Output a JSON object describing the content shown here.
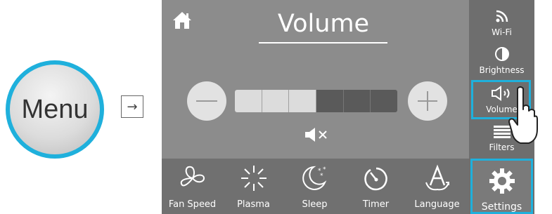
{
  "intro": {
    "menu_label": "Menu",
    "arrow": "→"
  },
  "screen": {
    "title": "Volume",
    "icons": {
      "home": "home-icon",
      "minus": "minus-icon",
      "plus": "plus-icon",
      "mute": "mute-icon"
    },
    "volume": {
      "level": 3,
      "max": 6
    }
  },
  "sidebar": {
    "items": [
      {
        "label": "Wi-Fi",
        "icon": "wifi-icon"
      },
      {
        "label": "Brightness",
        "icon": "brightness-icon"
      },
      {
        "label": "Volume",
        "icon": "volume-icon",
        "selected": true
      },
      {
        "label": "Filters",
        "icon": "filters-icon"
      },
      {
        "label": "Settings",
        "icon": "settings-icon",
        "selected": true
      }
    ]
  },
  "bottom_bar": {
    "items": [
      {
        "label": "Fan Speed",
        "icon": "fan-icon"
      },
      {
        "label": "Plasma",
        "icon": "plasma-icon"
      },
      {
        "label": "Sleep",
        "icon": "sleep-icon"
      },
      {
        "label": "Timer",
        "icon": "timer-icon"
      },
      {
        "label": "Language",
        "icon": "language-icon"
      }
    ]
  },
  "colors": {
    "highlight": "#1fb0dc",
    "panel": "#8c8c8c",
    "sidebar": "#6e6e6e"
  }
}
